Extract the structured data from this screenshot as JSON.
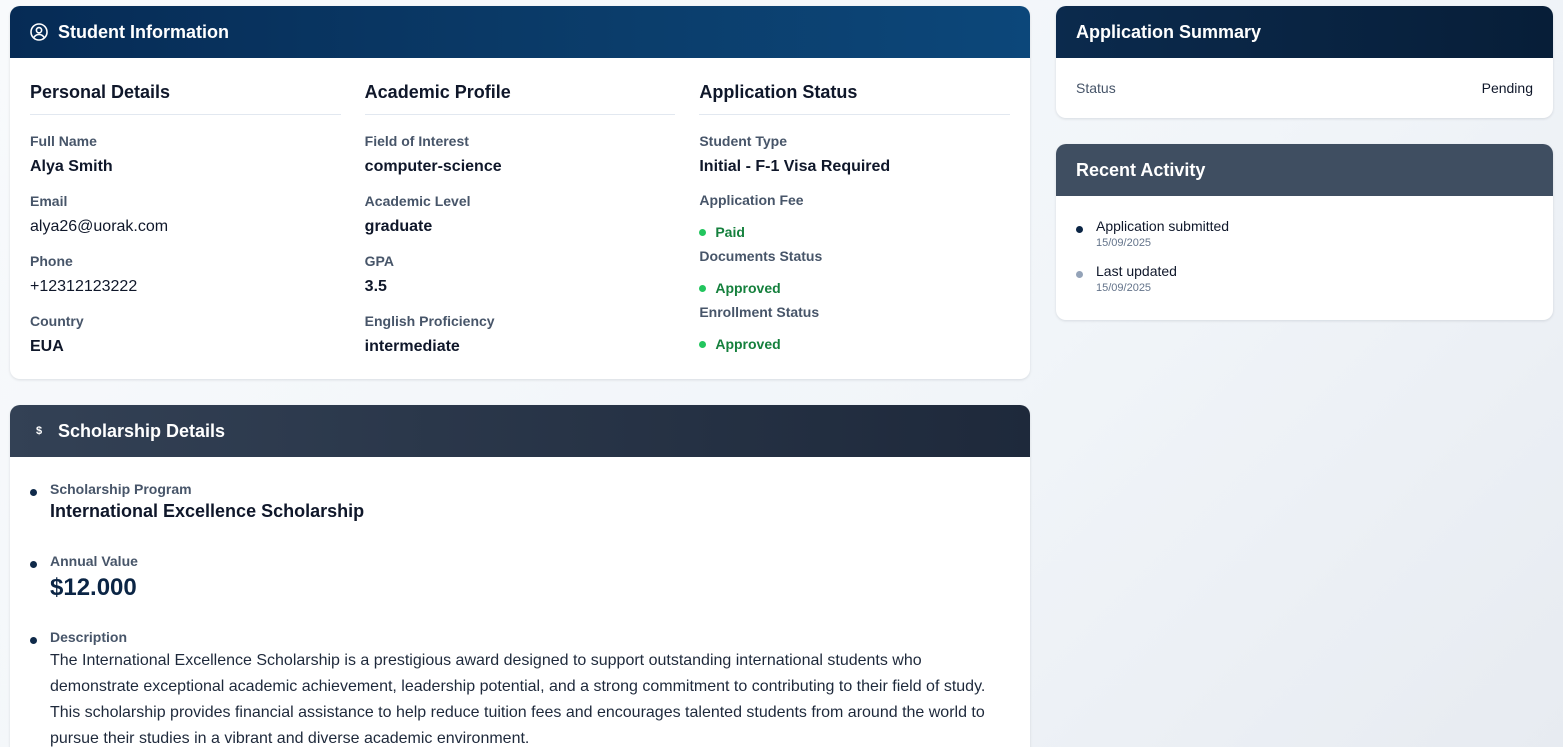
{
  "student_info": {
    "header_title": "Student Information",
    "header_icon": "user-circle-icon",
    "personal": {
      "title": "Personal Details",
      "fields": [
        {
          "label": "Full Name",
          "value": "Alya Smith"
        },
        {
          "label": "Email",
          "value": "alya26@uorak.com"
        },
        {
          "label": "Phone",
          "value": "+12312123222"
        },
        {
          "label": "Country",
          "value": "EUA"
        }
      ]
    },
    "academic": {
      "title": "Academic Profile",
      "fields": [
        {
          "label": "Field of Interest",
          "value": "computer-science"
        },
        {
          "label": "Academic Level",
          "value": "graduate"
        },
        {
          "label": "GPA",
          "value": "3.5"
        },
        {
          "label": "English Proficiency",
          "value": "intermediate"
        }
      ]
    },
    "status": {
      "title": "Application Status",
      "student_type_label": "Student Type",
      "student_type_value": "Initial - F-1 Visa Required",
      "items": [
        {
          "label": "Application Fee",
          "value": "Paid"
        },
        {
          "label": "Documents Status",
          "value": "Approved"
        },
        {
          "label": "Enrollment Status",
          "value": "Approved"
        }
      ],
      "status_color": "#22c55e"
    }
  },
  "scholarship": {
    "header_title": "Scholarship Details",
    "header_icon": "dollar-icon",
    "program_label": "Scholarship Program",
    "program_value": "International Excellence Scholarship",
    "annual_label": "Annual Value",
    "annual_value": "$12.000",
    "description_label": "Description",
    "description_value": "The International Excellence Scholarship is a prestigious award designed to support outstanding international students who demonstrate exceptional academic achievement, leadership potential, and a strong commitment to contributing to their field of study. This scholarship provides financial assistance to help reduce tuition fees and encourages talented students from around the world to pursue their studies in a vibrant and diverse academic environment."
  },
  "summary": {
    "header_title": "Application Summary",
    "status_label": "Status",
    "status_value": "Pending"
  },
  "activity": {
    "header_title": "Recent Activity",
    "items": [
      {
        "title": "Application submitted",
        "date": "15/09/2025",
        "dot_color": "#0b2545"
      },
      {
        "title": "Last updated",
        "date": "15/09/2025",
        "dot_color": "#94a3b8"
      }
    ]
  }
}
